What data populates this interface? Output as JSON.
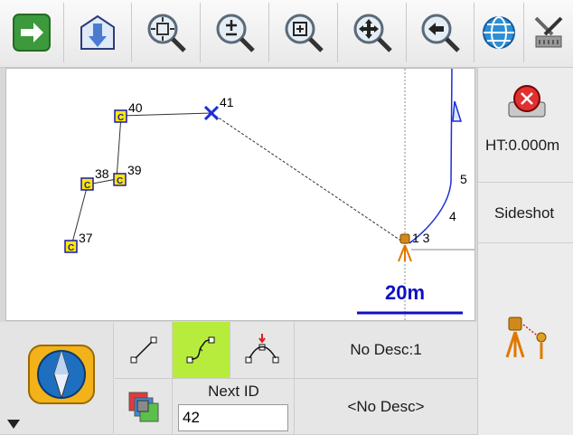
{
  "toolbar": {
    "buttons": [
      {
        "name": "forward-arrow-icon"
      },
      {
        "name": "import-icon"
      },
      {
        "name": "zoom-extents-icon"
      },
      {
        "name": "zoom-in-out-icon"
      },
      {
        "name": "zoom-window-icon"
      },
      {
        "name": "pan-icon"
      },
      {
        "name": "zoom-previous-icon"
      },
      {
        "name": "globe-icon"
      },
      {
        "name": "settings-tools-icon"
      }
    ]
  },
  "map": {
    "points": [
      {
        "id": "37",
        "code": "C"
      },
      {
        "id": "38",
        "code": "C"
      },
      {
        "id": "39",
        "code": "C"
      },
      {
        "id": "40",
        "code": "C"
      },
      {
        "id": "41"
      },
      {
        "id": "1 3"
      }
    ],
    "segment_labels": {
      "a": "5",
      "b": "4"
    },
    "scale_label": "20m",
    "colors": {
      "point_fill": "#ffe800",
      "point_border": "#1a1aa8",
      "blue_line": "#1a2ed6",
      "scale_text": "#1010c0"
    }
  },
  "side": {
    "ht_label": "HT:0.000m",
    "mode_label": "Sideshot"
  },
  "bottom": {
    "desc_button": "No Desc:1",
    "next_id_label": "Next ID",
    "next_id_value": "42",
    "desc2_button": "<No Desc>"
  }
}
